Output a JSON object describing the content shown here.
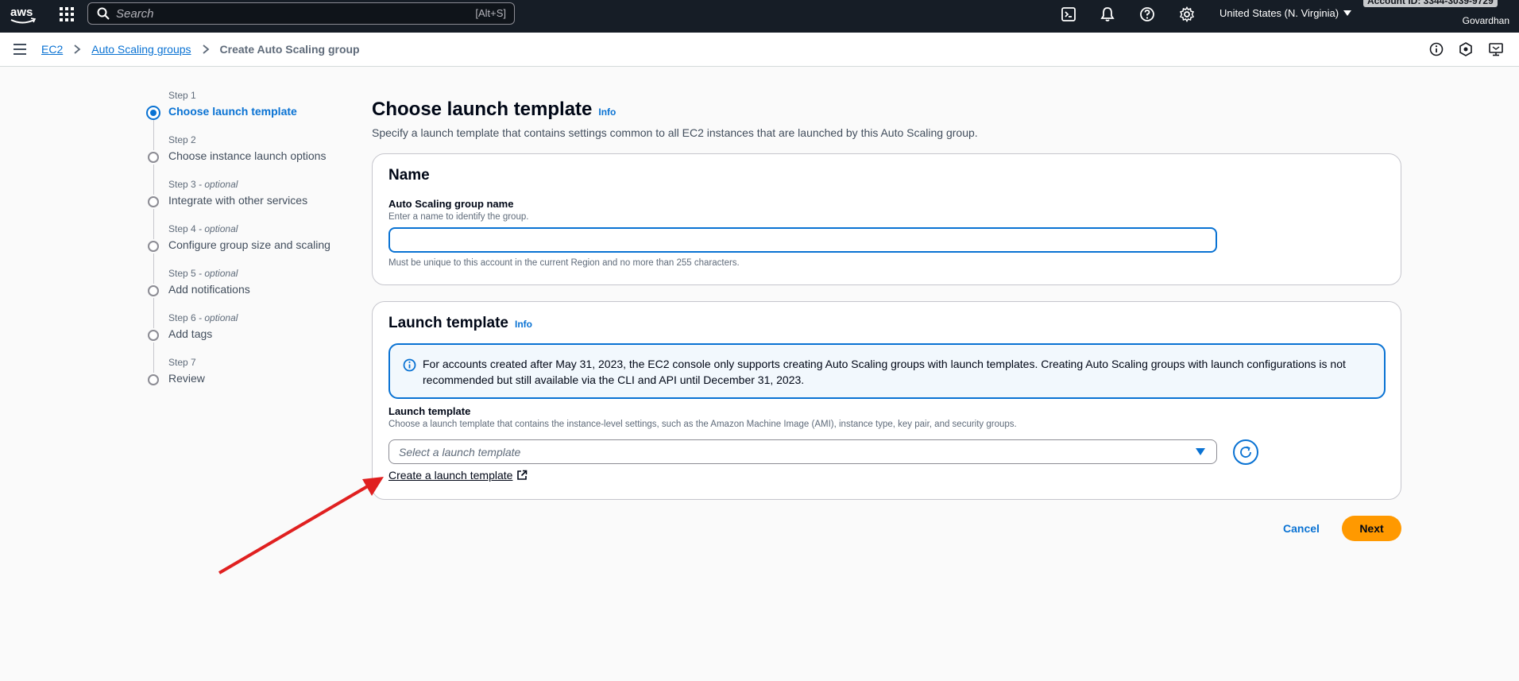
{
  "topnav": {
    "logo_text": "aws",
    "search_placeholder": "Search",
    "search_shortcut": "[Alt+S]",
    "region": "United States (N. Virginia)",
    "account": "Account ID: 3344-3039-9729",
    "username": "Govardhan",
    "icons": [
      "apps-icon",
      "search-icon",
      "cloudshell-icon",
      "bell-icon",
      "help-icon",
      "settings-icon"
    ]
  },
  "breadcrumb": {
    "items": [
      "EC2",
      "Auto Scaling groups"
    ],
    "current": "Create Auto Scaling group"
  },
  "steps": [
    {
      "num": "Step 1",
      "optional": "",
      "title": "Choose launch template",
      "active": true
    },
    {
      "num": "Step 2",
      "optional": "",
      "title": "Choose instance launch options",
      "active": false
    },
    {
      "num": "Step 3",
      "optional": " - optional",
      "title": "Integrate with other services",
      "active": false
    },
    {
      "num": "Step 4",
      "optional": " - optional",
      "title": "Configure group size and scaling",
      "active": false
    },
    {
      "num": "Step 5",
      "optional": " - optional",
      "title": "Add notifications",
      "active": false
    },
    {
      "num": "Step 6",
      "optional": " - optional",
      "title": "Add tags",
      "active": false
    },
    {
      "num": "Step 7",
      "optional": "",
      "title": "Review",
      "active": false
    }
  ],
  "main": {
    "title": "Choose launch template",
    "info": "Info",
    "description": "Specify a launch template that contains settings common to all EC2 instances that are launched by this Auto Scaling group."
  },
  "name_panel": {
    "heading": "Name",
    "field_label": "Auto Scaling group name",
    "field_desc": "Enter a name to identify the group.",
    "value": "",
    "hint": "Must be unique to this account in the current Region and no more than 255 characters."
  },
  "lt_panel": {
    "heading": "Launch template",
    "info": "Info",
    "alert": "For accounts created after May 31, 2023, the EC2 console only supports creating Auto Scaling groups with launch templates. Creating Auto Scaling groups with launch configurations is not recommended but still available via the CLI and API until December 31, 2023.",
    "field_label": "Launch template",
    "field_desc": "Choose a launch template that contains the instance-level settings, such as the Amazon Machine Image (AMI), instance type, key pair, and security groups.",
    "select_placeholder": "Select a launch template",
    "create_link": "Create a launch template"
  },
  "actions": {
    "cancel": "Cancel",
    "next": "Next"
  },
  "colors": {
    "nav_bg": "#161d26",
    "link": "#0972d3",
    "primary_button": "#ff9900",
    "annotation_arrow": "#e02020"
  }
}
